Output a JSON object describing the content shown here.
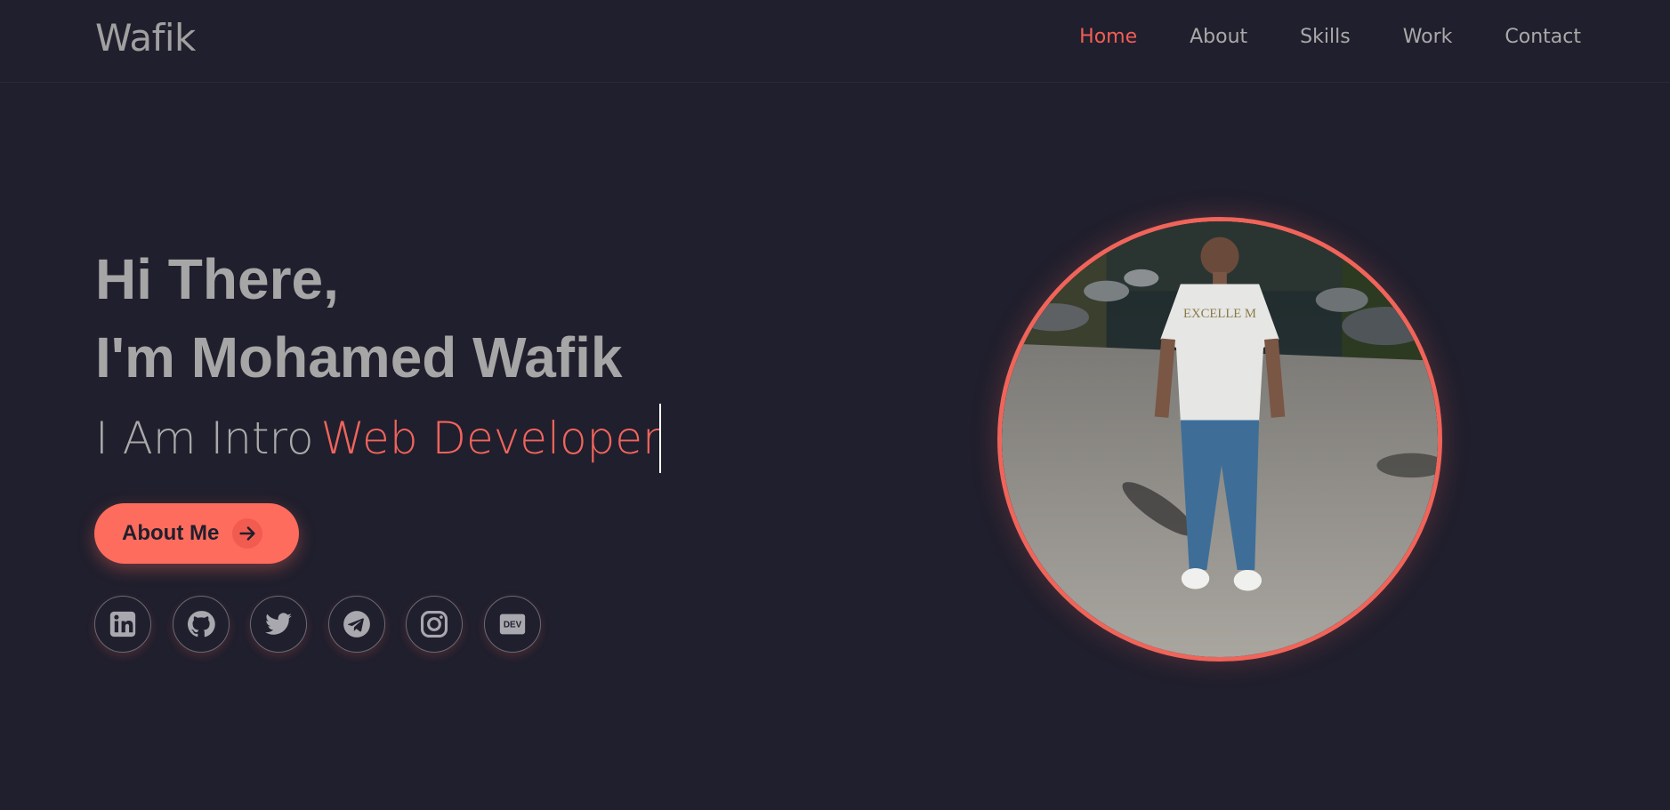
{
  "nav": {
    "logo": "Wafik",
    "links": [
      {
        "label": "Home",
        "active": true
      },
      {
        "label": "About",
        "active": false
      },
      {
        "label": "Skills",
        "active": false
      },
      {
        "label": "Work",
        "active": false
      },
      {
        "label": "Contact",
        "active": false
      }
    ]
  },
  "hero": {
    "greeting_line1": "Hi There,",
    "greeting_line2": "I'm Mohamed Wafik",
    "intro_prefix": "I Am Intro",
    "typed_role": "Web Developer",
    "about_button": "About Me",
    "photo_shirt_text": "EXCELLE M"
  },
  "socials": [
    {
      "name": "linkedin-icon"
    },
    {
      "name": "github-icon"
    },
    {
      "name": "twitter-icon"
    },
    {
      "name": "telegram-icon"
    },
    {
      "name": "instagram-icon"
    },
    {
      "name": "dev-icon",
      "text": "DEV"
    }
  ],
  "colors": {
    "background": "#201f2d",
    "accent": "#f15e55",
    "button": "#fe6c5d",
    "text": "#a9a9a9"
  }
}
